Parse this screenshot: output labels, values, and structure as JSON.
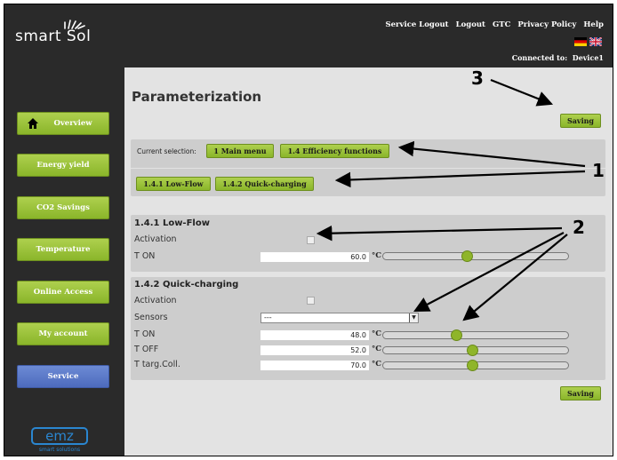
{
  "header": {
    "logo": "smart Sol",
    "links": [
      "Service Logout",
      "Logout",
      "GTC",
      "Privacy Policy",
      "Help"
    ],
    "connected_label": "Connected to:",
    "device": "Device1"
  },
  "sidebar": {
    "items": [
      {
        "label": "Overview"
      },
      {
        "label": "Energy yield"
      },
      {
        "label": "CO2 Savings"
      },
      {
        "label": "Temperature"
      },
      {
        "label": "Online Access"
      },
      {
        "label": "My account"
      },
      {
        "label": "Service"
      }
    ],
    "brand": "emz",
    "brand_sub": "smart solutions"
  },
  "main": {
    "title": "Parameterization",
    "save_label": "Saving",
    "selection": {
      "label": "Current selection:",
      "crumbs": [
        "1 Main menu",
        "1.4 Efficiency functions"
      ],
      "subitems": [
        "1.4.1 Low-Flow",
        "1.4.2 Quick-charging"
      ]
    },
    "lowflow": {
      "title": "1.4.1 Low-Flow",
      "activation_label": "Activation",
      "ton_label": "T ON",
      "ton_value": "60.0",
      "ton_level": 0.45,
      "unit": "°C"
    },
    "quick": {
      "title": "1.4.2 Quick-charging",
      "activation_label": "Activation",
      "sensors_label": "Sensors",
      "sensors_value": "---",
      "rows": [
        {
          "label": "T ON",
          "value": "48.0",
          "level": 0.39
        },
        {
          "label": "T OFF",
          "value": "52.0",
          "level": 0.48
        },
        {
          "label": "T targ.Coll.",
          "value": "70.0",
          "level": 0.48
        }
      ],
      "unit": "°C"
    }
  },
  "annotations": [
    "1",
    "2",
    "3"
  ],
  "colors": {
    "accent": "#8ab52a",
    "active": "#4d6bbd",
    "dark": "#2a2a2a",
    "panel": "#cdcdcd"
  }
}
